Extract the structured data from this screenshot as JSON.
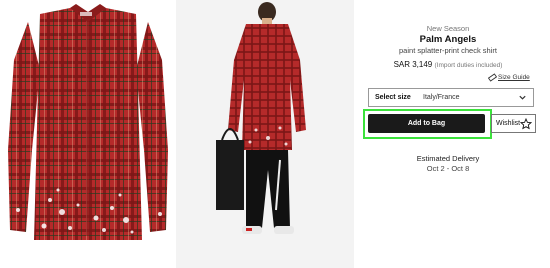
{
  "product": {
    "season": "New Season",
    "brand": "Palm Angels",
    "description": "paint splatter-print check shirt",
    "price": "SAR 3,149",
    "duties_note": "(Import duties included)",
    "size_guide_label": "Size Guide"
  },
  "size_select": {
    "label": "Select size",
    "value": "Italy/France"
  },
  "actions": {
    "add_to_bag_label": "Add to Bag",
    "wishlist_label": "Wishlist"
  },
  "delivery": {
    "title": "Estimated Delivery",
    "dates": "Oct 2 - Oct 8"
  },
  "images": [
    {
      "name": "product-flat-image",
      "icon": "plaid-shirt"
    },
    {
      "name": "product-model-image",
      "icon": "model-wearing-shirt"
    }
  ],
  "colors": {
    "plaid_red": "#b52a2a",
    "highlight": "#3be23b",
    "button_dark": "#1a1a1a"
  }
}
